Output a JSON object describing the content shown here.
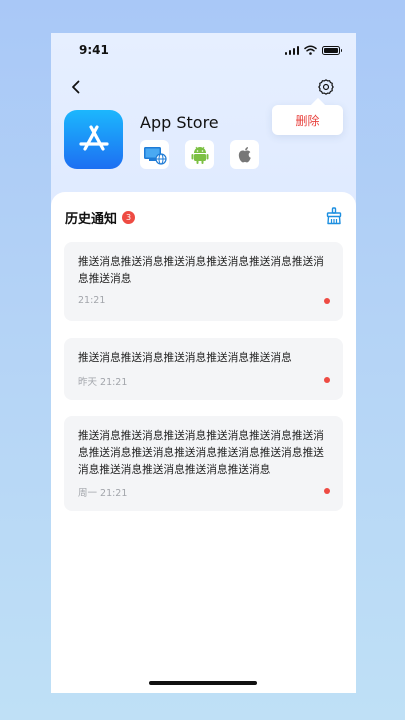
{
  "status_bar": {
    "time": "9:41"
  },
  "app": {
    "name": "App Store"
  },
  "popup": {
    "delete_label": "删除"
  },
  "platforms": [
    "web-globe-icon",
    "android-icon",
    "apple-icon"
  ],
  "section": {
    "title": "历史通知",
    "count": "3"
  },
  "notifications": [
    {
      "text": "推送消息推送消息推送消息推送消息推送消息推送消息推送消息",
      "time": "21:21"
    },
    {
      "text": "推送消息推送消息推送消息推送消息推送消息",
      "time": "昨天 21:21"
    },
    {
      "text": "推送消息推送消息推送消息推送消息推送消息推送消息推送消息推送消息推送消息推送消息推送消息推送消息推送消息推送消息推送消息推送消息",
      "time": "周一 21:21"
    }
  ],
  "colors": {
    "accent": "#1d8fe0",
    "badge": "#ee4b43",
    "delete": "#e8413d"
  }
}
